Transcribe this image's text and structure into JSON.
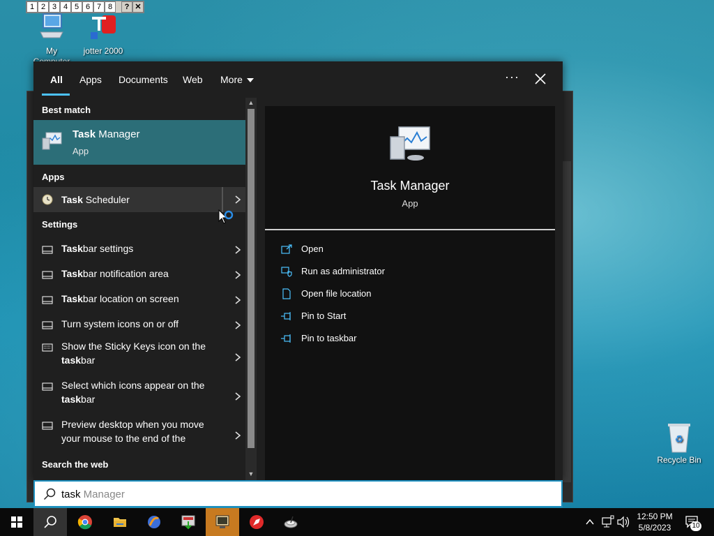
{
  "desk_switcher": {
    "buttons": [
      "1",
      "2",
      "3",
      "4",
      "5",
      "6",
      "7",
      "8"
    ],
    "help": "?",
    "close": "✕"
  },
  "desktop": {
    "icons": [
      {
        "label_line1": "My",
        "label_line2": "Computer"
      },
      {
        "label": "jotter 2000"
      }
    ],
    "recycle_bin": "Recycle Bin"
  },
  "search": {
    "tabs": {
      "all": "All",
      "apps": "Apps",
      "documents": "Documents",
      "web": "Web",
      "more": "More"
    },
    "options_glyph": "···",
    "sections": {
      "best_match": "Best match",
      "apps": "Apps",
      "settings": "Settings",
      "search_web": "Search the web"
    },
    "best_match": {
      "title_bold": "Task",
      "title_rest": " Manager",
      "subtitle": "App"
    },
    "apps": [
      {
        "bold": "Task",
        "rest": " Scheduler"
      }
    ],
    "settings": [
      {
        "bold": "Task",
        "rest": "bar settings"
      },
      {
        "bold": "Task",
        "rest": "bar notification area"
      },
      {
        "bold": "Task",
        "rest": "bar location on screen"
      },
      {
        "pre": "Turn system icons on or off"
      },
      {
        "line1": "Show the Sticky Keys icon on the",
        "line2_bold": "task",
        "line2_rest": "bar"
      },
      {
        "line1": "Select which icons appear on the",
        "line2_bold": "task",
        "line2_rest": "bar"
      },
      {
        "line1": "Preview desktop when you move",
        "line2": "your mouse to the end of the"
      }
    ],
    "preview": {
      "title": "Task Manager",
      "subtitle": "App",
      "actions": [
        "Open",
        "Run as administrator",
        "Open file location",
        "Pin to Start",
        "Pin to taskbar"
      ]
    },
    "query_typed": "task",
    "query_suggestion": " Manager"
  },
  "tray": {
    "time": "12:50 PM",
    "date": "5/8/2023",
    "notification_count": "10"
  },
  "colors": {
    "accent": "#4cc2ff",
    "best_match_bg": "#2c6e78",
    "panel_bg": "#1f1f1f",
    "search_border": "#1e90c0"
  }
}
